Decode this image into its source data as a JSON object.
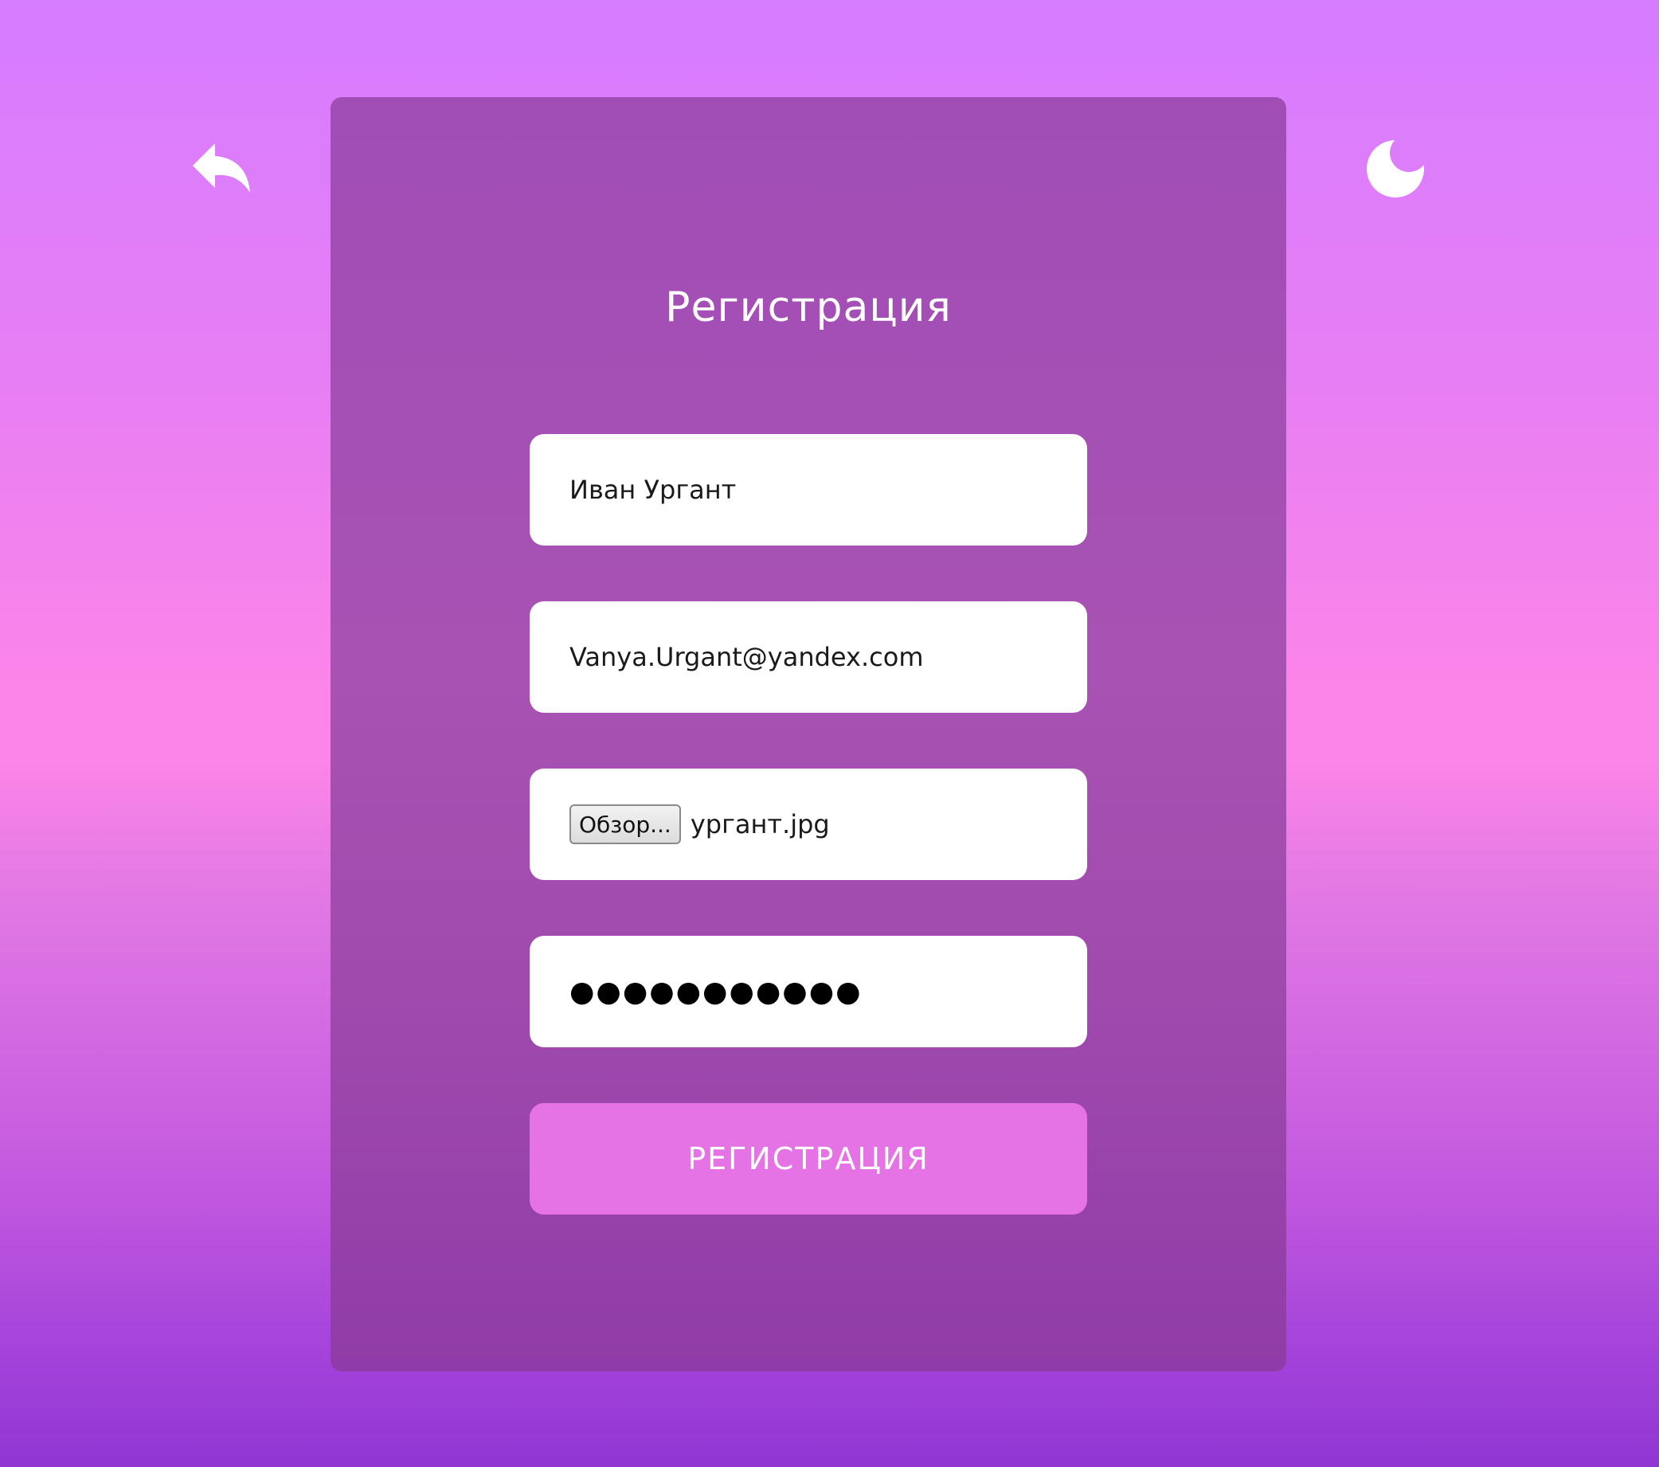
{
  "header": {
    "back_icon": "reply-arrow-icon",
    "theme_icon": "moon-icon"
  },
  "form": {
    "title": "Регистрация",
    "name_value": "Иван Ургант",
    "email_value": "Vanya.Urgant@yandex.com",
    "file_button_label": "Обзор...",
    "file_name": "ургант.jpg",
    "password_value": "●●●●●●●●●●●",
    "submit_label": "РЕГИСТРАЦИЯ"
  },
  "colors": {
    "card": "#a04db6",
    "button": "#e673e6",
    "field": "#ffffff"
  }
}
